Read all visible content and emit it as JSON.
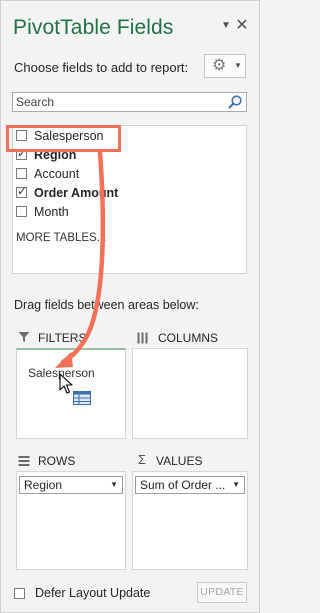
{
  "pane": {
    "title": "PivotTable Fields",
    "menu_icon": "dropdown-caret-icon",
    "close_icon": "close-icon"
  },
  "chooser": {
    "label": "Choose fields to add to report:",
    "tools_icon": "gear-icon"
  },
  "search": {
    "placeholder": "Search",
    "icon": "search-icon"
  },
  "fields": [
    {
      "label": "Salesperson",
      "checked": false,
      "bold": false
    },
    {
      "label": "Region",
      "checked": true,
      "bold": true
    },
    {
      "label": "Account",
      "checked": false,
      "bold": false
    },
    {
      "label": "Order Amount",
      "checked": true,
      "bold": true
    },
    {
      "label": "Month",
      "checked": false,
      "bold": false
    }
  ],
  "more_tables": "MORE TABLES...",
  "areas": {
    "label": "Drag fields between areas below:",
    "filters": {
      "title": "FILTERS",
      "icon": "filter-icon",
      "dragged_item": "Salesperson"
    },
    "columns": {
      "title": "COLUMNS",
      "icon": "columns-icon"
    },
    "rows": {
      "title": "ROWS",
      "icon": "rows-icon",
      "item": "Region"
    },
    "values": {
      "title": "VALUES",
      "icon": "sigma-icon",
      "item": "Sum of Order ..."
    }
  },
  "footer": {
    "defer_label": "Defer Layout Update",
    "defer_checked": false,
    "update_label": "UPDATE"
  },
  "colors": {
    "title": "#217346",
    "highlight": "#f07158",
    "arrow": "#f07158"
  }
}
